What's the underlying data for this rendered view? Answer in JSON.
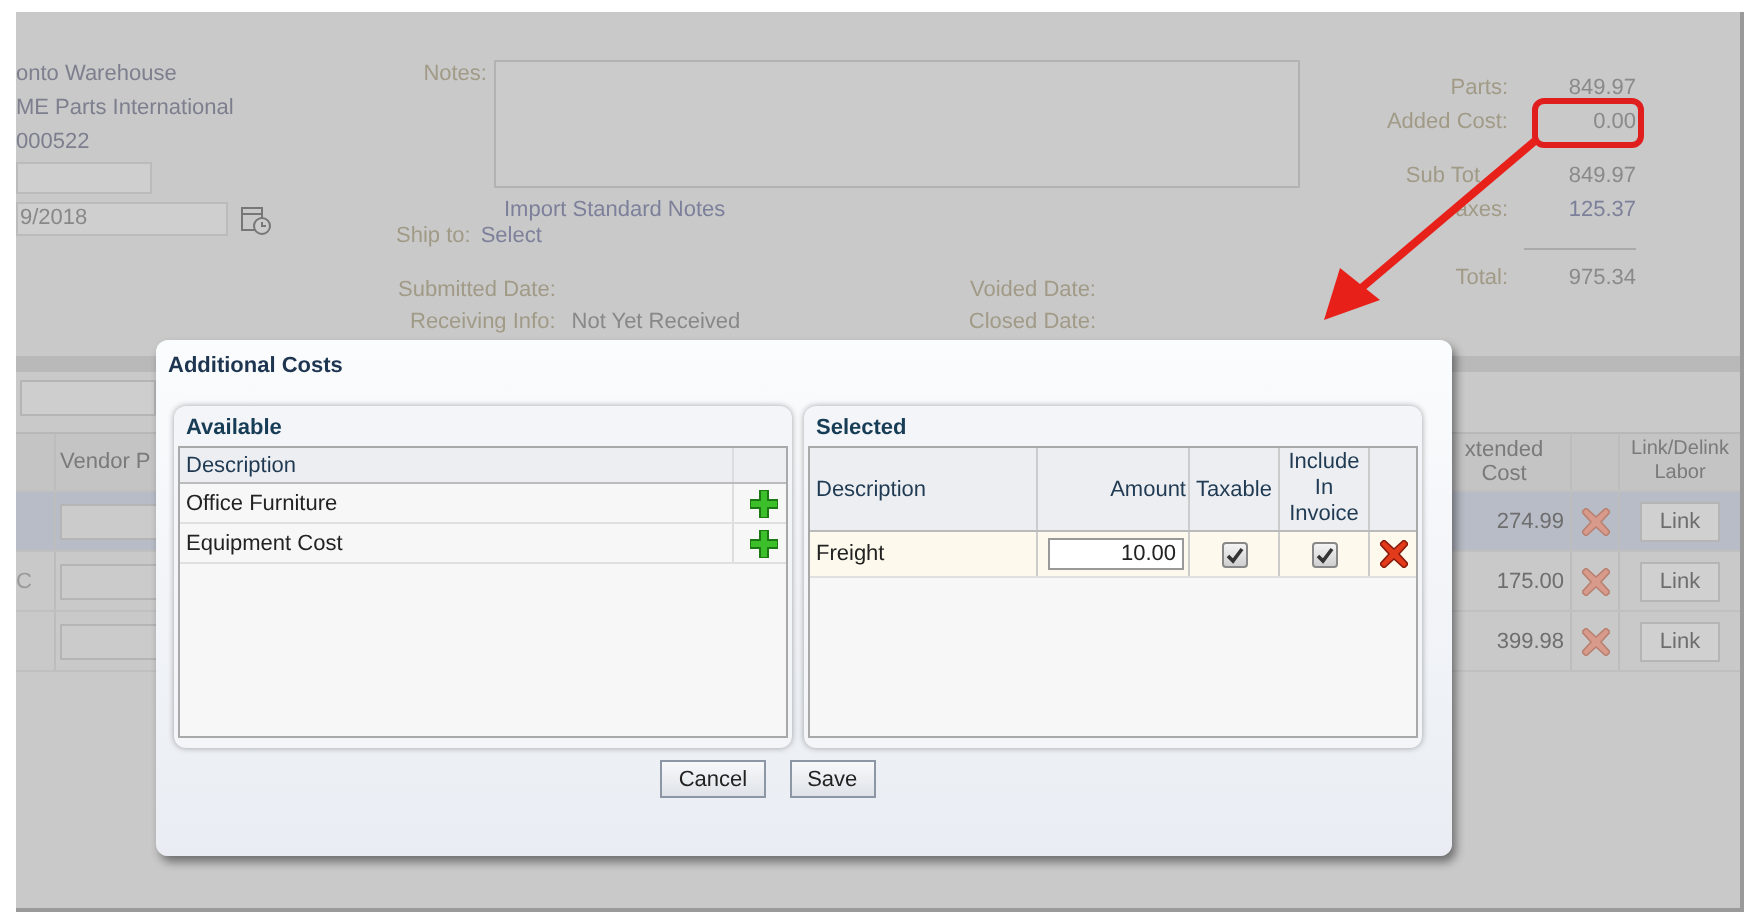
{
  "background_form": {
    "location_lines": [
      "onto Warehouse",
      "ME Parts International",
      "000522"
    ],
    "date_field": {
      "value": "9/2018"
    },
    "notes": {
      "label": "Notes:",
      "link": "Import Standard Notes"
    },
    "ship_to": {
      "label": "Ship to:",
      "value": "Select"
    },
    "dates_left": [
      {
        "label": "Submitted Date:"
      },
      {
        "label": "Receiving Info:",
        "value": "Not Yet Received"
      }
    ],
    "dates_right": [
      {
        "label": "Voided Date:"
      },
      {
        "label": "Closed Date:"
      }
    ],
    "totals": [
      {
        "label": "Parts:",
        "value": "849.97",
        "highlighted": false,
        "rule_above": false
      },
      {
        "label": "Added Cost:",
        "value": "0.00",
        "highlighted": true,
        "rule_above": false
      },
      {
        "label": "Sub Tot",
        "value": "849.97",
        "highlighted": false,
        "rule_above": false
      },
      {
        "label": "axes:",
        "value": "125.37",
        "highlighted": false,
        "rule_above": false
      },
      {
        "label": "Total:",
        "value": "975.34",
        "highlighted": false,
        "rule_above": true
      }
    ],
    "table": {
      "columns": [
        "Vendor P",
        "xtended Cost",
        "Link/Delink Labor"
      ],
      "rows": [
        {
          "selected": true,
          "lead": "",
          "extended_cost": "274.99",
          "link": "Link"
        },
        {
          "selected": false,
          "lead": "C",
          "extended_cost": "175.00",
          "link": "Link"
        },
        {
          "selected": false,
          "lead": "",
          "extended_cost": "399.98",
          "link": "Link"
        }
      ]
    }
  },
  "dialog": {
    "title": "Additional Costs",
    "available": {
      "title": "Available",
      "columns": [
        "Description"
      ],
      "rows": [
        {
          "description": "Office Furniture"
        },
        {
          "description": "Equipment Cost"
        }
      ]
    },
    "selected": {
      "title": "Selected",
      "columns": [
        "Description",
        "Amount",
        "Taxable",
        "Include In Invoice"
      ],
      "rows": [
        {
          "description": "Freight",
          "amount": "10.00",
          "taxable": true,
          "include_in_invoice": true
        }
      ]
    },
    "buttons": [
      "Cancel",
      "Save"
    ]
  }
}
